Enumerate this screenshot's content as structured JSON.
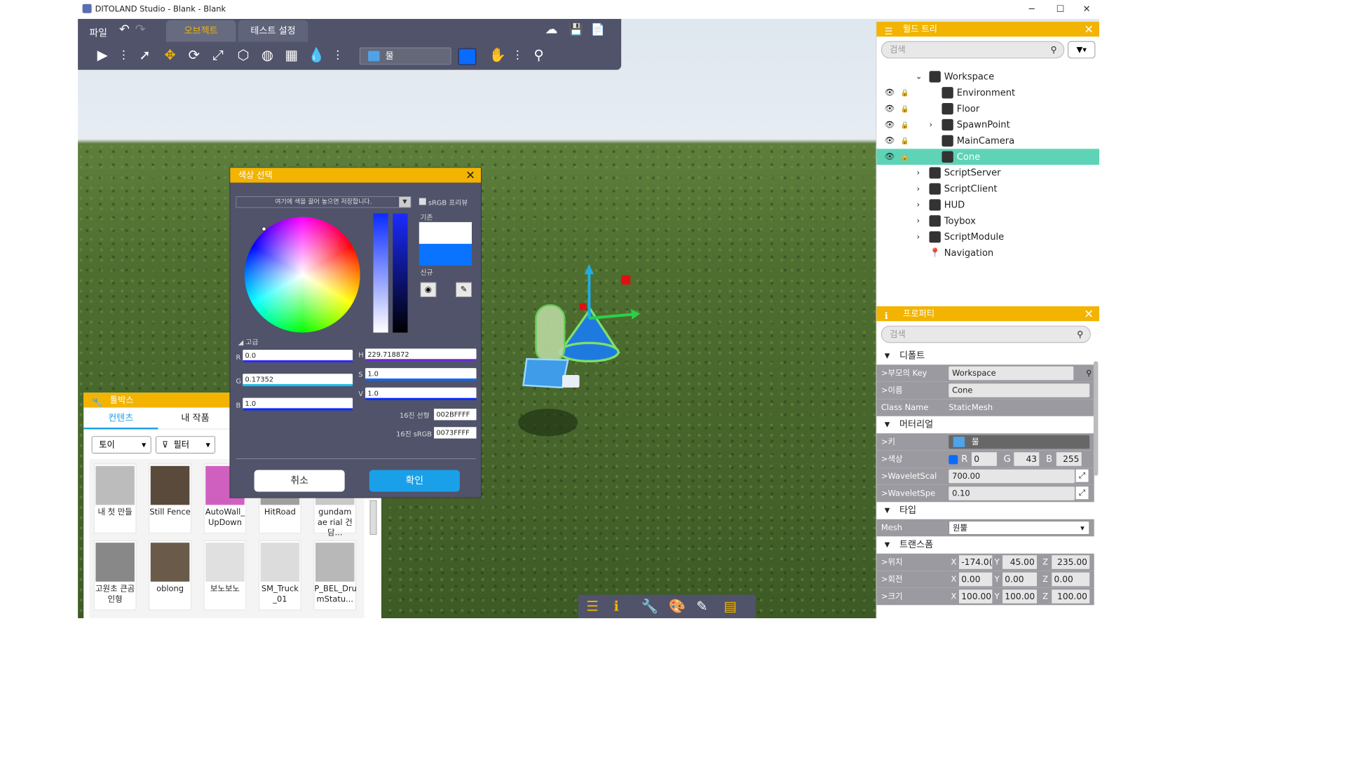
{
  "window": {
    "title": "DITOLAND Studio - Blank - Blank",
    "minimize": "─",
    "maximize": "☐",
    "close": "✕"
  },
  "toolbar": {
    "file": "파일",
    "undo": "↶",
    "redo": "↷",
    "tabs": [
      "오브젝트",
      "테스트 설정"
    ],
    "material": "물",
    "upload": "☁",
    "save": "💾",
    "newfile": "📄",
    "play": "▶",
    "more": "⋮"
  },
  "color_dialog": {
    "title": "색상 선택",
    "drop_hint": "여기에 색을 끌어 놓으면 저장합니다.",
    "srgb_preview": "sRGB 프리뷰",
    "current_label": "기존",
    "new_label": "신규",
    "advanced": "◢ 고급",
    "R_label": "R",
    "G_label": "G",
    "B_label": "B",
    "H_label": "H",
    "S_label": "S",
    "V_label": "V",
    "R": "0.0",
    "G": "0.17",
    "G_rest": "352",
    "B": "1.0",
    "H": "229.718872",
    "S": "1.0",
    "V": "1.0",
    "hex_linear_label": "16진 선형",
    "hex_linear": "002BFFFF",
    "hex_srgb_label": "16진 sRGB",
    "hex_srgb": "0073FFFF",
    "cancel": "취소",
    "ok": "확인",
    "close": "✕"
  },
  "toolbox": {
    "title": "툴박스",
    "tabs": [
      "컨텐츠",
      "내 작품"
    ],
    "category": "토이",
    "filter": "필터",
    "items": [
      {
        "label": "내 첫 만들"
      },
      {
        "label": "Still Fence"
      },
      {
        "label": "AutoWall_ UpDown"
      },
      {
        "label": "HitRoad"
      },
      {
        "label": "gundam ae rial 건담..."
      },
      {
        "label": "고원초 큰곰 인형"
      },
      {
        "label": "oblong"
      },
      {
        "label": "보노보노"
      },
      {
        "label": "SM_Truck _01"
      },
      {
        "label": "P_BEL_Dru mStatu..."
      }
    ]
  },
  "worldtree": {
    "title": "월드 트리",
    "search_placeholder": "검색",
    "items": [
      "Workspace",
      "Environment",
      "Floor",
      "SpawnPoint",
      "MainCamera",
      "Cone",
      "ScriptServer",
      "ScriptClient",
      "HUD",
      "Toybox",
      "ScriptModule",
      "Navigation"
    ]
  },
  "properties": {
    "title": "프로퍼티",
    "search_placeholder": "검색",
    "sections": {
      "default": "디폴트",
      "material": "머터리얼",
      "type": "타입",
      "transform": "트랜스폼"
    },
    "parent_key_label": ">부모의 Key",
    "parent_key": "Workspace",
    "name_label": ">이름",
    "name": "Cone",
    "classname_label": "Class Name",
    "classname": "StaticMesh",
    "key_label": ">키",
    "key": "물",
    "color_label": ">색상",
    "R_label": "R",
    "G_label": "G",
    "B_label": "B",
    "color_r": "0",
    "color_g": "43",
    "color_b": "255",
    "wavelet_scale_label": ">WaveletScal",
    "wavelet_scale": "700.00",
    "wavelet_speed_label": ">WaveletSpe",
    "wavelet_speed": "0.10",
    "mesh_label": "Mesh",
    "mesh": "원뿔",
    "X_label": "X",
    "Y_label": "Y",
    "Z_label": "Z",
    "pos_label": ">위치",
    "pos": [
      "-174.0(",
      "45.00",
      "235.00"
    ],
    "rot_label": ">회전",
    "rot": [
      "0.00",
      "0.00",
      "0.00"
    ],
    "scale_label": ">크기",
    "scale": [
      "100.00",
      "100.00",
      "100.00"
    ]
  },
  "colors": {
    "accent": "#f2b400",
    "panel": "#50536a",
    "selected": "#5fd3b5",
    "water": "#0a73ff"
  }
}
